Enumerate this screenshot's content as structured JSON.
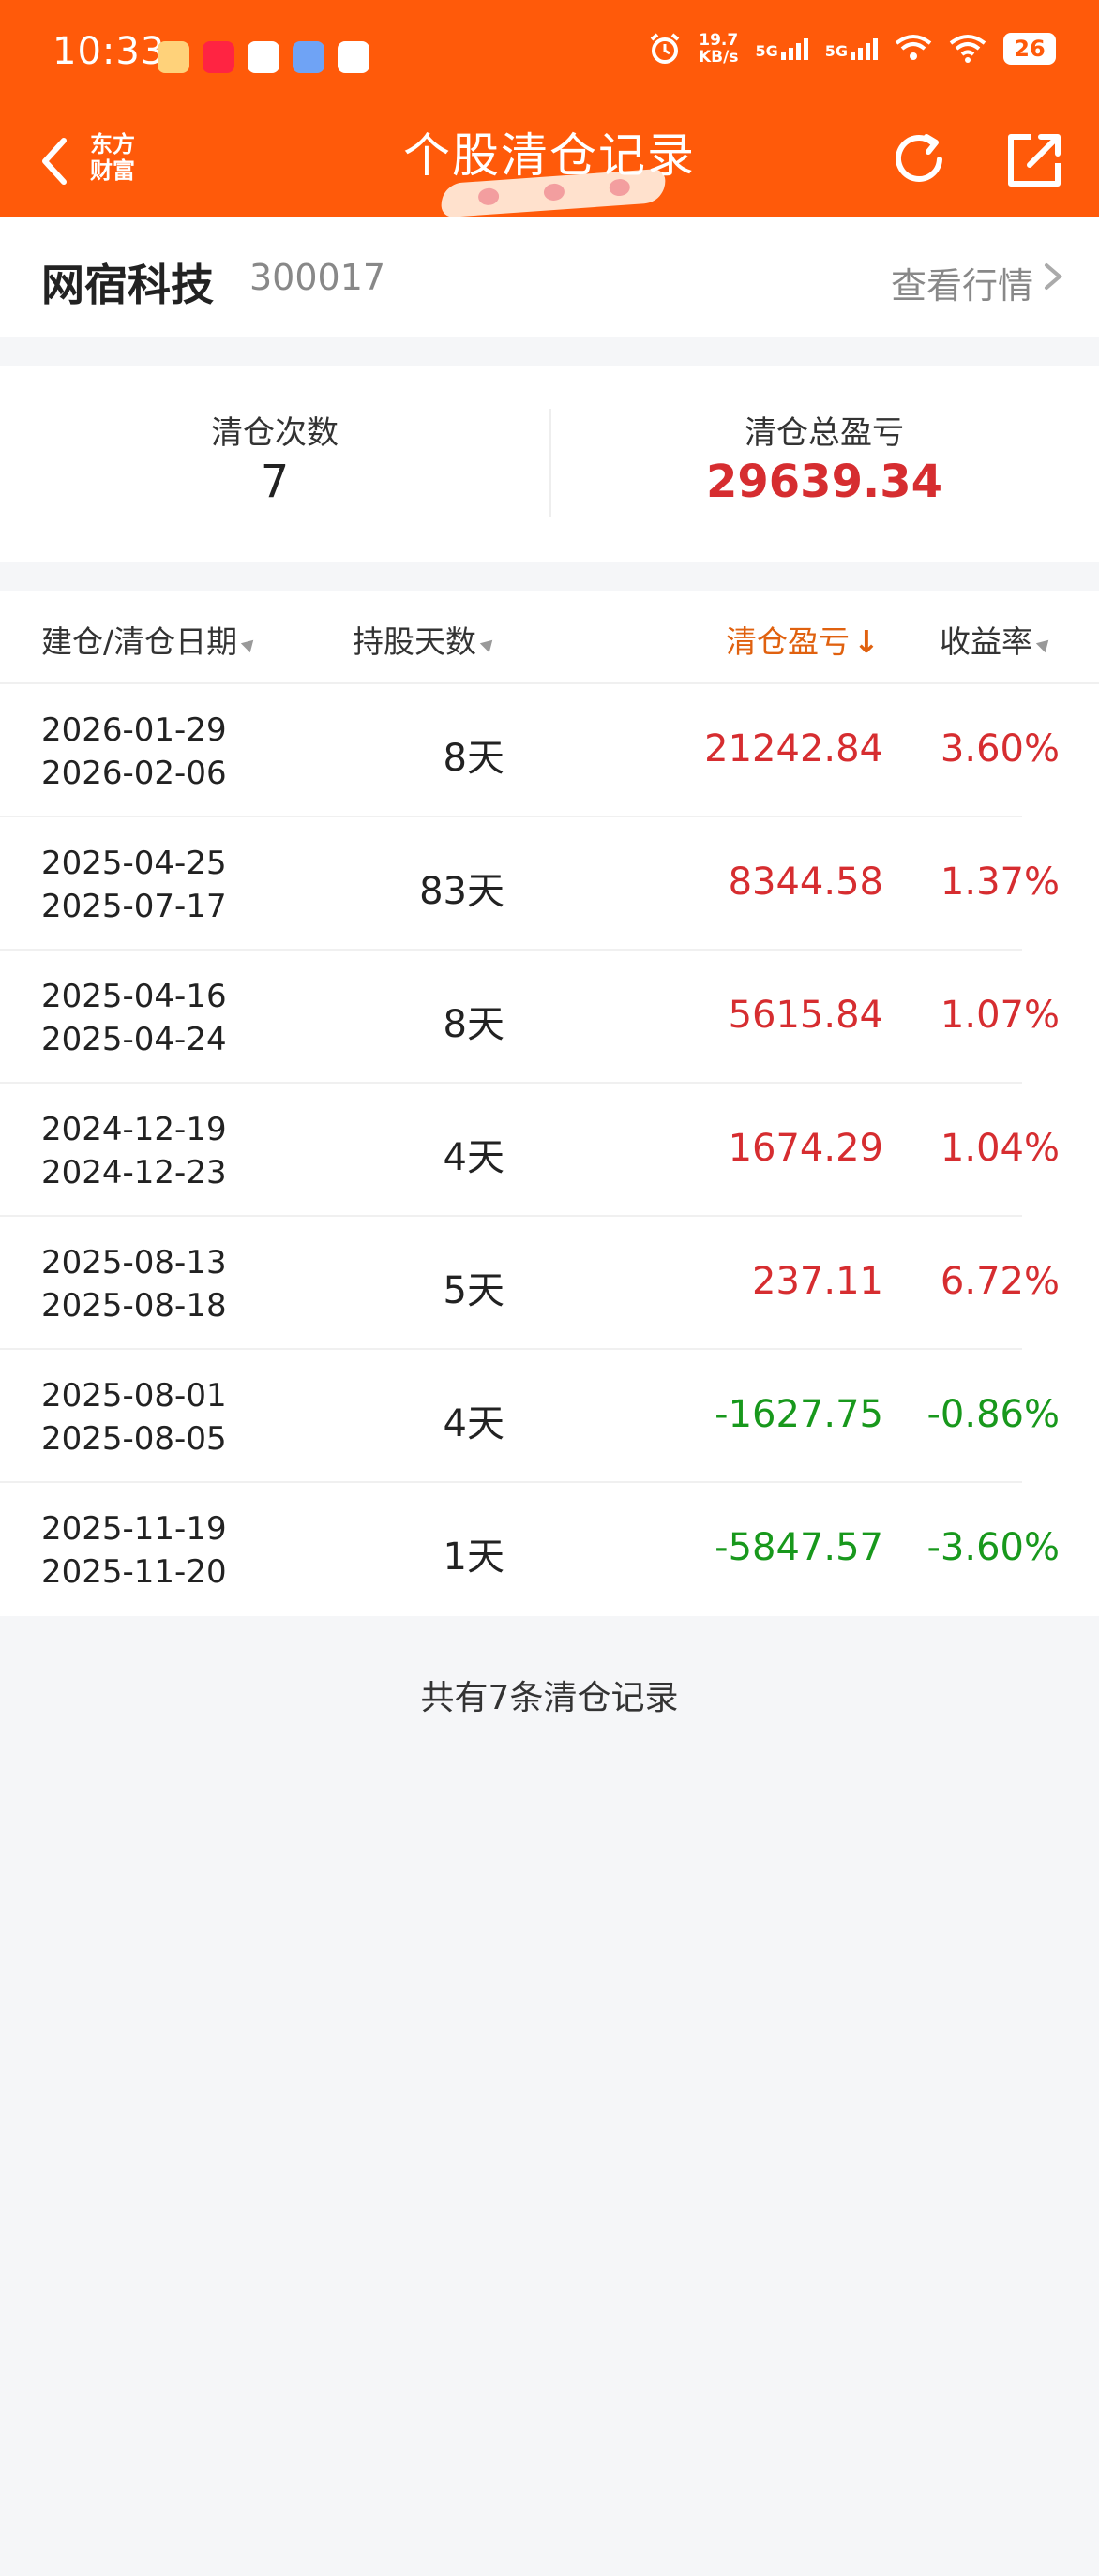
{
  "status_bar": {
    "time": "10:33",
    "net_speed_value": "19.7",
    "net_speed_unit": "KB/s",
    "sim1": "5G",
    "sim2": "5G",
    "battery": "26"
  },
  "header": {
    "logo_line1": "东方",
    "logo_line2": "财富",
    "title": "个股清仓记录",
    "accent_color": "#ff5a0a"
  },
  "stock": {
    "name": "网宿科技",
    "code": "300017",
    "quote_link": "查看行情"
  },
  "summary": {
    "count_label": "清仓次数",
    "count_value": "7",
    "total_label": "清仓总盈亏",
    "total_value": "29639.34"
  },
  "table": {
    "headers": {
      "date": "建仓/清仓日期",
      "days": "持股天数",
      "profit": "清仓盈亏",
      "rate": "收益率"
    },
    "rows": [
      {
        "open": "2026-01-29",
        "close": "2026-02-06",
        "days": "8天",
        "profit": "21242.84",
        "rate": "3.60%",
        "trend": "up"
      },
      {
        "open": "2025-04-25",
        "close": "2025-07-17",
        "days": "83天",
        "profit": "8344.58",
        "rate": "1.37%",
        "trend": "up"
      },
      {
        "open": "2025-04-16",
        "close": "2025-04-24",
        "days": "8天",
        "profit": "5615.84",
        "rate": "1.07%",
        "trend": "up"
      },
      {
        "open": "2024-12-19",
        "close": "2024-12-23",
        "days": "4天",
        "profit": "1674.29",
        "rate": "1.04%",
        "trend": "up"
      },
      {
        "open": "2025-08-13",
        "close": "2025-08-18",
        "days": "5天",
        "profit": "237.11",
        "rate": "6.72%",
        "trend": "up"
      },
      {
        "open": "2025-08-01",
        "close": "2025-08-05",
        "days": "4天",
        "profit": "-1627.75",
        "rate": "-0.86%",
        "trend": "down"
      },
      {
        "open": "2025-11-19",
        "close": "2025-11-20",
        "days": "1天",
        "profit": "-5847.57",
        "rate": "-3.60%",
        "trend": "down"
      }
    ]
  },
  "footer": {
    "text": "共有7条清仓记录"
  },
  "colors": {
    "gain": "#d62d30",
    "loss": "#18981c",
    "active_sort": "#e0610f"
  }
}
